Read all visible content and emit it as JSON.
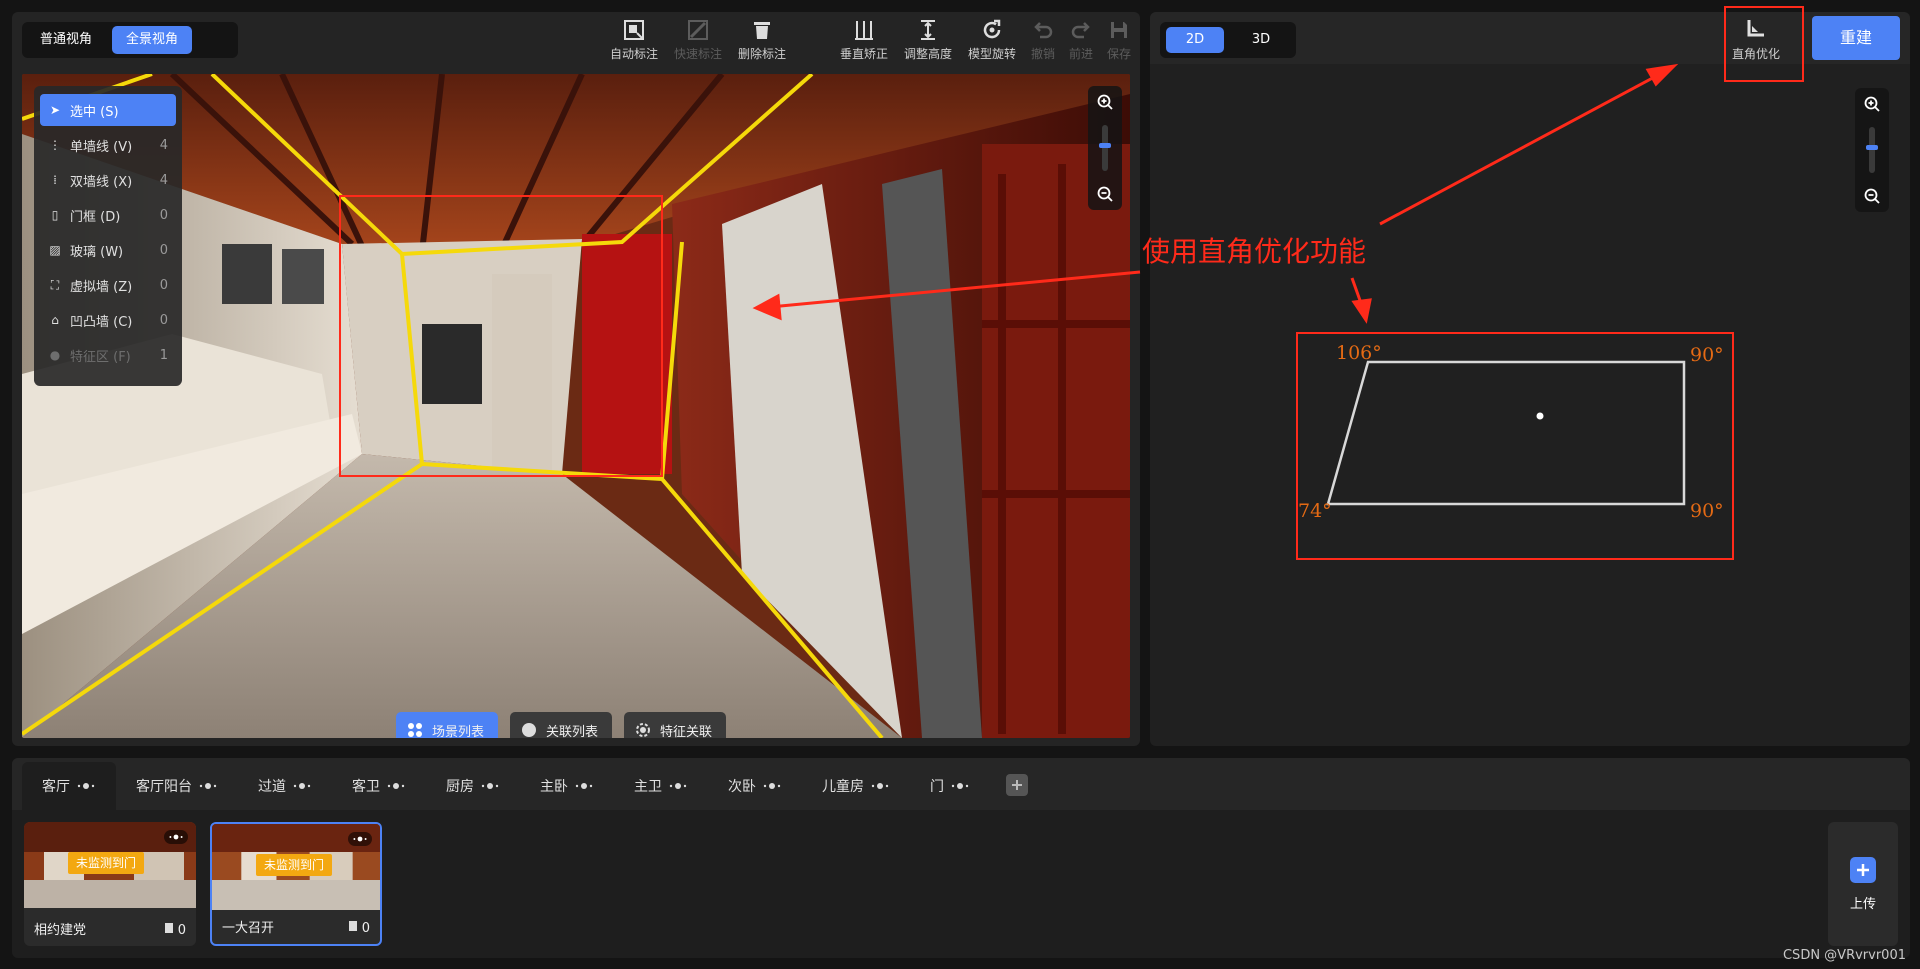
{
  "left_panel": {
    "view_modes": [
      {
        "label": "普通视角",
        "active": false
      },
      {
        "label": "全景视角",
        "active": true
      }
    ],
    "toolbar": [
      {
        "icon": "auto-annotate-icon",
        "label": "自动标注",
        "disabled": false
      },
      {
        "icon": "quick-annotate-icon",
        "label": "快速标注",
        "disabled": true
      },
      {
        "icon": "trash-icon",
        "label": "删除标注",
        "disabled": false
      },
      {
        "icon": "vertical-correct-icon",
        "label": "垂直矫正",
        "disabled": false
      },
      {
        "icon": "adjust-height-icon",
        "label": "调整高度",
        "disabled": false
      },
      {
        "icon": "rotate-model-icon",
        "label": "模型旋转",
        "disabled": false
      },
      {
        "icon": "undo-icon",
        "label": "撤销",
        "disabled": true
      },
      {
        "icon": "redo-icon",
        "label": "前进",
        "disabled": true
      },
      {
        "icon": "save-icon",
        "label": "保存",
        "disabled": true
      }
    ],
    "palette": [
      {
        "icon": "cursor-icon",
        "label": "选中 (S)",
        "count": "",
        "active": true,
        "disabled": false
      },
      {
        "icon": "single-wall-icon",
        "label": "单墙线 (V)",
        "count": "4",
        "active": false,
        "disabled": false
      },
      {
        "icon": "double-wall-icon",
        "label": "双墙线 (X)",
        "count": "4",
        "active": false,
        "disabled": false
      },
      {
        "icon": "door-frame-icon",
        "label": "门框 (D)",
        "count": "0",
        "active": false,
        "disabled": false
      },
      {
        "icon": "glass-icon",
        "label": "玻璃 (W)",
        "count": "0",
        "active": false,
        "disabled": false
      },
      {
        "icon": "virtual-wall-icon",
        "label": "虚拟墙 (Z)",
        "count": "0",
        "active": false,
        "disabled": false
      },
      {
        "icon": "concave-wall-icon",
        "label": "凹凸墙 (C)",
        "count": "0",
        "active": false,
        "disabled": false
      },
      {
        "icon": "feature-zone-icon",
        "label": "特征区 (F)",
        "count": "1",
        "active": false,
        "disabled": true
      }
    ],
    "bottom_buttons": [
      {
        "icon": "scene-list-icon",
        "label": "场景列表",
        "primary": true
      },
      {
        "icon": "link-list-icon",
        "label": "关联列表",
        "primary": false
      },
      {
        "icon": "feature-link-icon",
        "label": "特征关联",
        "primary": false
      }
    ]
  },
  "right_panel": {
    "dims": [
      {
        "label": "2D",
        "active": true
      },
      {
        "label": "3D",
        "active": false
      }
    ],
    "right_angle_tool": "直角优化",
    "rebuild": "重建",
    "annotation": "使用直角优化功能",
    "floorplan_angles": {
      "top_left": "106°",
      "top_right": "90°",
      "bottom_left": "74°",
      "bottom_right": "90°"
    }
  },
  "rooms": [
    {
      "label": "客厅",
      "active": true
    },
    {
      "label": "客厅阳台",
      "active": false
    },
    {
      "label": "过道",
      "active": false
    },
    {
      "label": "客卫",
      "active": false
    },
    {
      "label": "厨房",
      "active": false
    },
    {
      "label": "主卧",
      "active": false
    },
    {
      "label": "主卫",
      "active": false
    },
    {
      "label": "次卧",
      "active": false
    },
    {
      "label": "儿童房",
      "active": false
    },
    {
      "label": "门",
      "active": false
    }
  ],
  "scenes": [
    {
      "name": "相约建党",
      "badge": "未监测到门",
      "count": "0",
      "selected": false
    },
    {
      "name": "一大召开",
      "badge": "未监测到门",
      "count": "0",
      "selected": true
    }
  ],
  "upload": "上传",
  "watermark": "CSDN @VRvrvr001",
  "colors": {
    "accent": "#4d82f5",
    "annotation_red": "#ff2a1a",
    "wall_line_yellow": "#f5d90a",
    "angle_label_orange": "#e46a14",
    "badge_orange": "#f3a811"
  }
}
